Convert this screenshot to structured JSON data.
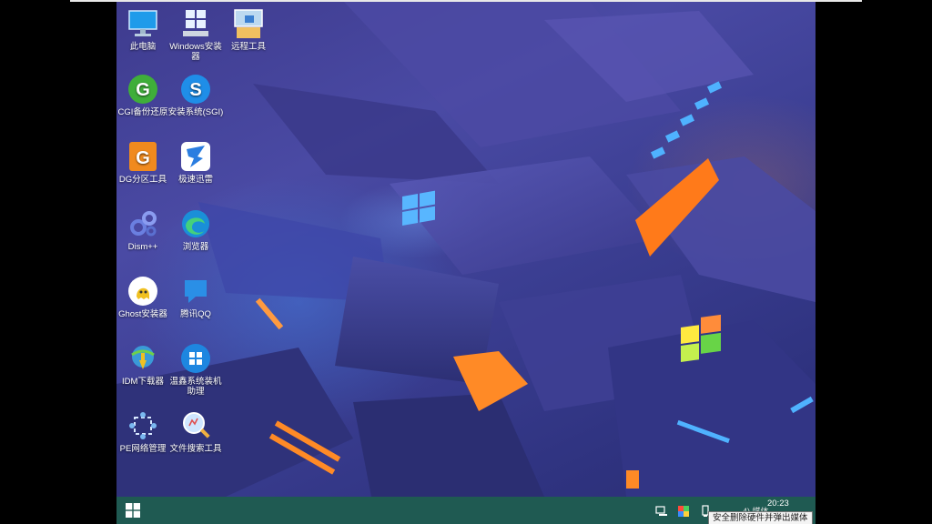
{
  "desktop": {
    "icons": [
      {
        "label": "此电脑",
        "icon": "computer-icon"
      },
      {
        "label": "Windows安装器",
        "icon": "windows-installer-icon"
      },
      {
        "label": "远程工具",
        "icon": "remote-tool-icon"
      },
      {
        "label": "CGI备份还原",
        "icon": "cgi-backup-icon"
      },
      {
        "label": "安装系统(SGI)",
        "icon": "sgi-install-icon"
      },
      {
        "label": "DG分区工具",
        "icon": "diskgenius-icon"
      },
      {
        "label": "极速迅雷",
        "icon": "thunder-icon"
      },
      {
        "label": "Dism++",
        "icon": "dism-icon"
      },
      {
        "label": "浏览器",
        "icon": "edge-browser-icon"
      },
      {
        "label": "Ghost安装器",
        "icon": "ghost-installer-icon"
      },
      {
        "label": "腾讯QQ",
        "icon": "qq-icon"
      },
      {
        "label": "IDM下载器",
        "icon": "idm-downloader-icon"
      },
      {
        "label": "温鑫系统装机助理",
        "icon": "install-assistant-icon"
      },
      {
        "label": "PE网络管理",
        "icon": "network-manager-icon"
      },
      {
        "label": "文件搜索工具",
        "icon": "file-search-icon"
      }
    ]
  },
  "taskbar": {
    "start_icon": "windows-start-icon",
    "tray_hidden_text": "4) 媒体",
    "clock": "20:23",
    "tooltip": "安全删除硬件并弹出媒体"
  },
  "colors": {
    "taskbar": "#1f5a52",
    "wallpaper": "#3e3b8e",
    "accent_orange": "#ff7a1a",
    "accent_blue": "#4fb2ff"
  }
}
